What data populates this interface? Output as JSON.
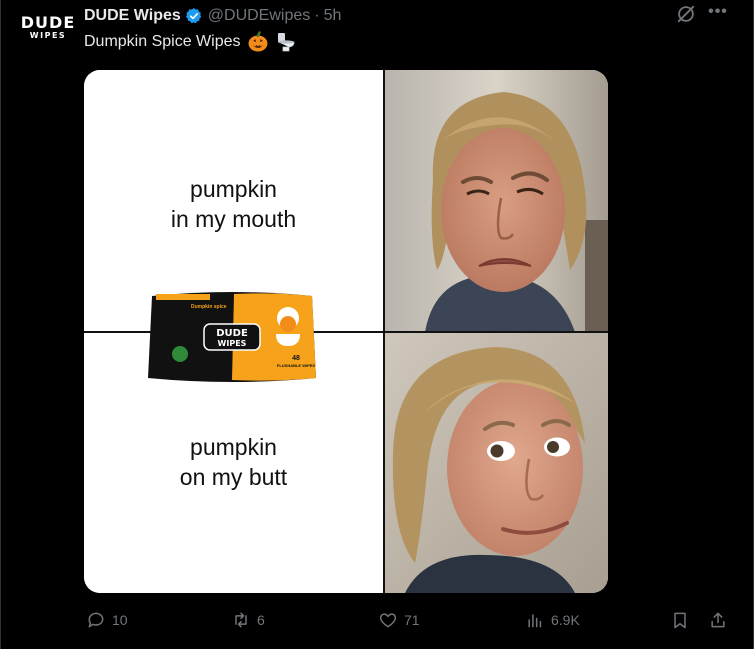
{
  "author": {
    "name": "DUDE Wipes",
    "handle": "@DUDEwipes",
    "separator": "·",
    "time": "5h",
    "avatar_logo_line1": "DUDE",
    "avatar_logo_line2": "WIPES"
  },
  "tweet": {
    "text": "Dumpkin Spice Wipes",
    "emojis": [
      "jack-o-lantern",
      "toilet"
    ]
  },
  "meme": {
    "top_caption": "pumpkin\nin my mouth",
    "bottom_caption": "pumpkin\non my butt",
    "product": {
      "brand_line1": "DUDE",
      "brand_line2": "WIPES",
      "variant": "Dumpkin spice",
      "count": "48",
      "count_label": "FLUSHABLE WIPES"
    }
  },
  "actions": {
    "replies": "10",
    "reposts": "6",
    "likes": "71",
    "views": "6.9K"
  },
  "colors": {
    "background": "#000000",
    "text": "#e7e9ea",
    "muted": "#71767b",
    "verified": "#1d9bf0",
    "wipes_orange": "#f7a21b"
  },
  "icons": [
    "verified-badge-icon",
    "grok-icon",
    "more-icon",
    "reply-icon",
    "repost-icon",
    "like-icon",
    "views-icon",
    "bookmark-icon",
    "share-icon"
  ]
}
